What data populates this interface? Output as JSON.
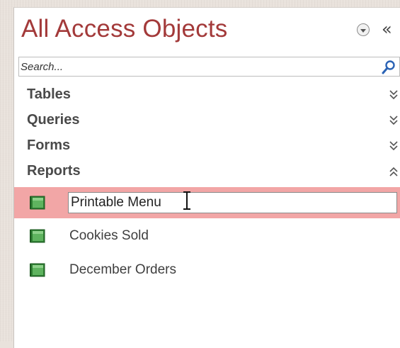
{
  "nav_pane": {
    "title": "All Access Objects",
    "dropdown_icon": "dropdown-circle-icon",
    "collapse_label": "«",
    "search": {
      "placeholder": "Search...",
      "value": ""
    },
    "groups": [
      {
        "label": "Tables",
        "expanded": false
      },
      {
        "label": "Queries",
        "expanded": false
      },
      {
        "label": "Forms",
        "expanded": false
      },
      {
        "label": "Reports",
        "expanded": true
      }
    ],
    "reports": [
      {
        "label": "Printable Menu",
        "selected": true,
        "renaming": true
      },
      {
        "label": "Cookies Sold",
        "selected": false
      },
      {
        "label": "December Orders",
        "selected": false
      }
    ]
  },
  "colors": {
    "title": "#a33a3a",
    "selection": "#f2a6a6",
    "report_icon": "#3c8a3c"
  }
}
